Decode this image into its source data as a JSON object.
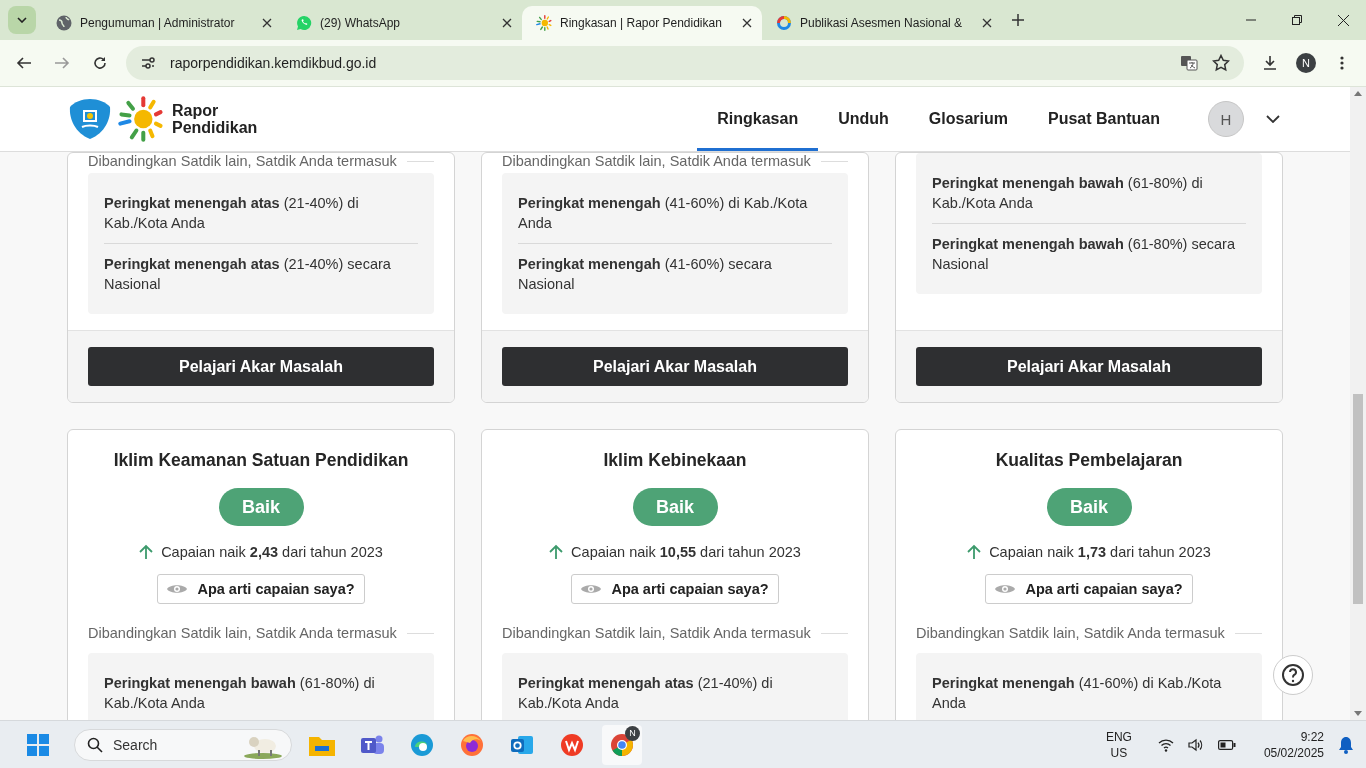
{
  "browser": {
    "tabs": [
      {
        "title": "Pengumuman | Administrator",
        "kind": "globe",
        "selected": false
      },
      {
        "title": "(29) WhatsApp",
        "kind": "whatsapp",
        "selected": false
      },
      {
        "title": "Ringkasan | Rapor Pendidikan",
        "kind": "sun",
        "selected": true
      },
      {
        "title": "Publikasi Asesmen Nasional &",
        "kind": "ring",
        "selected": false
      }
    ],
    "url": "raporpendidikan.kemdikbud.go.id",
    "profile": "N"
  },
  "header": {
    "logo": [
      "Rapor",
      "Pendidikan"
    ],
    "nav": [
      {
        "label": "Ringkasan",
        "selected": true
      },
      {
        "label": "Unduh",
        "selected": false
      },
      {
        "label": "Glosarium",
        "selected": false
      },
      {
        "label": "Pusat Bantuan",
        "selected": false
      }
    ],
    "avatar": "H"
  },
  "top_cards": [
    {
      "compare": "Dibandingkan Satdik lain, Satdik Anda termasuk",
      "ranks": [
        "**Peringkat menengah atas** (21-40%) di Kab./Kota Anda",
        "**Peringkat menengah atas** (21-40%) secara Nasional"
      ],
      "button": "Pelajari Akar Masalah"
    },
    {
      "compare": "Dibandingkan Satdik lain, Satdik Anda termasuk",
      "ranks": [
        "**Peringkat menengah** (41-60%) di Kab./Kota Anda",
        "**Peringkat menengah** (41-60%) secara Nasional"
      ],
      "button": "Pelajari Akar Masalah"
    },
    {
      "ranks": [
        "**Peringkat menengah bawah** (61-80%) di Kab./Kota Anda",
        "**Peringkat menengah bawah** (61-80%) secara Nasional"
      ],
      "button": "Pelajari Akar Masalah"
    }
  ],
  "cards": [
    {
      "title": "Iklim Keamanan Satuan Pendidikan",
      "status": "Baik",
      "change": "Capaian naik **2,43** dari tahun 2023",
      "help": "Apa arti capaian saya?",
      "compare": "Dibandingkan Satdik lain, Satdik Anda termasuk",
      "ranks": [
        "**Peringkat menengah bawah** (61-80%) di Kab./Kota Anda"
      ]
    },
    {
      "title": "Iklim Kebinekaan",
      "status": "Baik",
      "change": "Capaian naik **10,55** dari tahun 2023",
      "help": "Apa arti capaian saya?",
      "compare": "Dibandingkan Satdik lain, Satdik Anda termasuk",
      "ranks": [
        "**Peringkat menengah atas** (21-40%) di Kab./Kota Anda"
      ]
    },
    {
      "title": "Kualitas Pembelajaran",
      "status": "Baik",
      "change": "Capaian naik **1,73** dari tahun 2023",
      "help": "Apa arti capaian saya?",
      "compare": "Dibandingkan Satdik lain, Satdik Anda termasuk",
      "ranks": [
        "**Peringkat menengah** (41-60%) di Kab./Kota Anda"
      ]
    }
  ],
  "taskbar": {
    "search": "Search",
    "lang": [
      "ENG",
      "US"
    ],
    "time": "9:22",
    "date": "05/02/2025",
    "chrome_badge": "N"
  }
}
